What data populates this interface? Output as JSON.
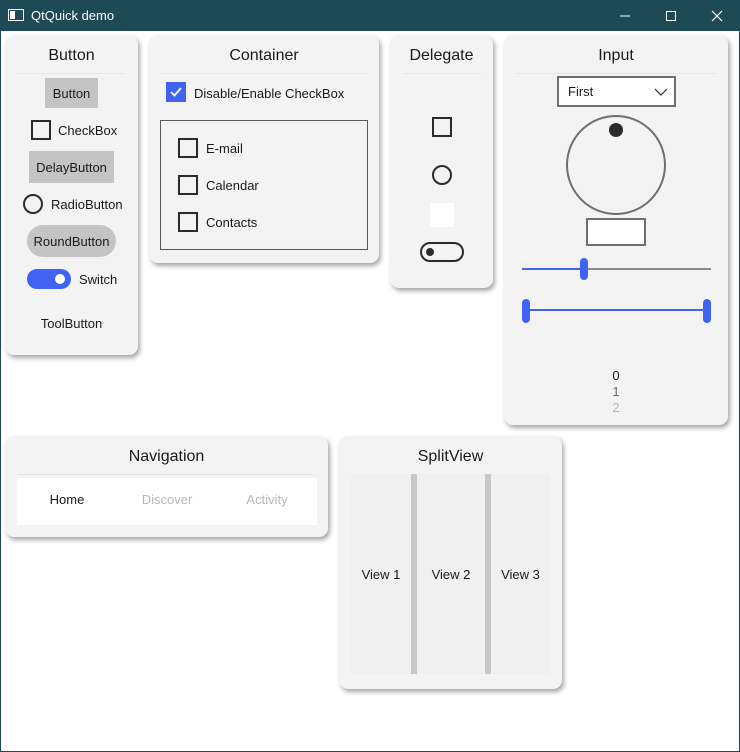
{
  "window": {
    "title": "QtQuick demo"
  },
  "button_card": {
    "title": "Button",
    "button": "Button",
    "checkbox": "CheckBox",
    "delay_button": "DelayButton",
    "radio_button": "RadioButton",
    "round_button": "RoundButton",
    "switch": "Switch",
    "tool_button": "ToolButton"
  },
  "container_card": {
    "title": "Container",
    "enable_checkbox": "Disable/Enable CheckBox",
    "items": [
      "E-mail",
      "Calendar",
      "Contacts"
    ]
  },
  "delegate_card": {
    "title": "Delegate"
  },
  "input_card": {
    "title": "Input",
    "combo_value": "First",
    "tumbler": [
      "0",
      "1",
      "2"
    ]
  },
  "navigation_card": {
    "title": "Navigation",
    "tabs": [
      "Home",
      "Discover",
      "Activity"
    ]
  },
  "splitview_card": {
    "title": "SplitView",
    "views": [
      "View 1",
      "View 2",
      "View 3"
    ]
  },
  "colors": {
    "accent": "#3f63f2",
    "titlebar": "#1e4a55"
  }
}
